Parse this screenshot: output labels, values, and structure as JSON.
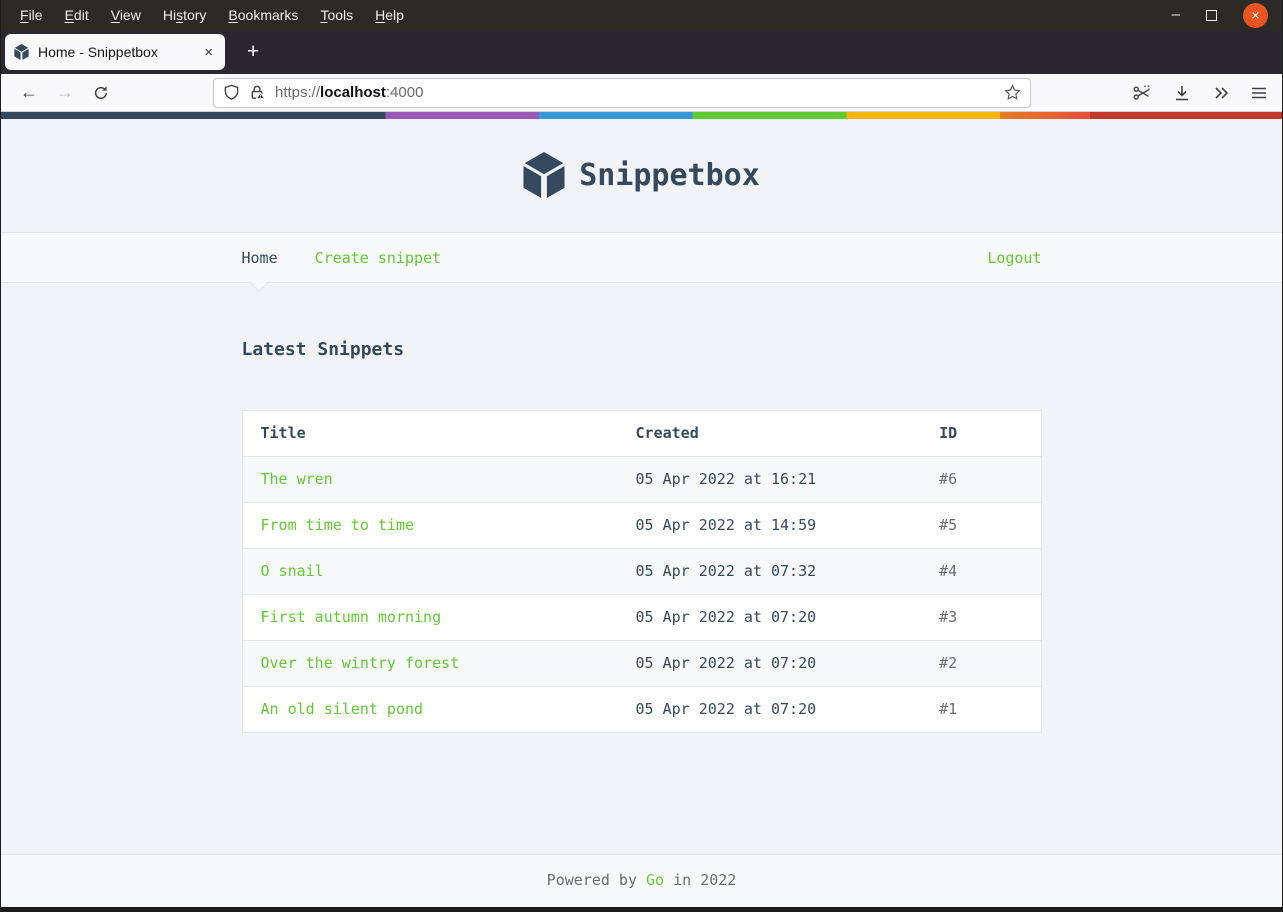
{
  "chrome": {
    "menu": [
      {
        "pre": "",
        "key": "F",
        "post": "ile"
      },
      {
        "pre": "",
        "key": "E",
        "post": "dit"
      },
      {
        "pre": "",
        "key": "V",
        "post": "iew"
      },
      {
        "pre": "Hi",
        "key": "s",
        "post": "tory"
      },
      {
        "pre": "",
        "key": "B",
        "post": "ookmarks"
      },
      {
        "pre": "",
        "key": "T",
        "post": "ools"
      },
      {
        "pre": "",
        "key": "H",
        "post": "elp"
      }
    ],
    "window_controls": {
      "minimize_glyph": "–",
      "close_glyph": "×"
    },
    "tab": {
      "title": "Home - Snippetbox",
      "close_glyph": "×",
      "new_tab_glyph": "+"
    },
    "nav_buttons": {
      "back_glyph": "←",
      "forward_glyph": "→"
    },
    "urlbar": {
      "scheme": "https://",
      "host": "localhost",
      "port": ":4000"
    }
  },
  "page": {
    "brand": "Snippetbox",
    "nav": {
      "home": "Home",
      "create_snippet": "Create snippet",
      "logout": "Logout"
    },
    "heading": "Latest Snippets",
    "table": {
      "headers": {
        "title": "Title",
        "created": "Created",
        "id": "ID"
      },
      "rows": [
        {
          "title": "The wren",
          "created": "05 Apr 2022 at 16:21",
          "id": "#6"
        },
        {
          "title": "From time to time",
          "created": "05 Apr 2022 at 14:59",
          "id": "#5"
        },
        {
          "title": "O snail",
          "created": "05 Apr 2022 at 07:32",
          "id": "#4"
        },
        {
          "title": "First autumn morning",
          "created": "05 Apr 2022 at 07:20",
          "id": "#3"
        },
        {
          "title": "Over the wintry forest",
          "created": "05 Apr 2022 at 07:20",
          "id": "#2"
        },
        {
          "title": "An old silent pond",
          "created": "05 Apr 2022 at 07:20",
          "id": "#1"
        }
      ]
    },
    "footer": {
      "prefix": "Powered by ",
      "link": "Go",
      "suffix": " in 2022"
    }
  },
  "colors": {
    "accent_green": "#62CB31",
    "brand_navy": "#34495E",
    "body_bg": "#F1F3F6",
    "panel_bg": "#F7F9FA",
    "border": "#E4E5E7",
    "muted_gray": "#6A6C6F",
    "close_button_orange": "#E95420",
    "rainbow_bar": [
      "#34495E",
      "#9B59B6",
      "#3498DB",
      "#62CB31",
      "#FFB606",
      "#E67E22",
      "#E74C3C",
      "#C0392B"
    ]
  }
}
